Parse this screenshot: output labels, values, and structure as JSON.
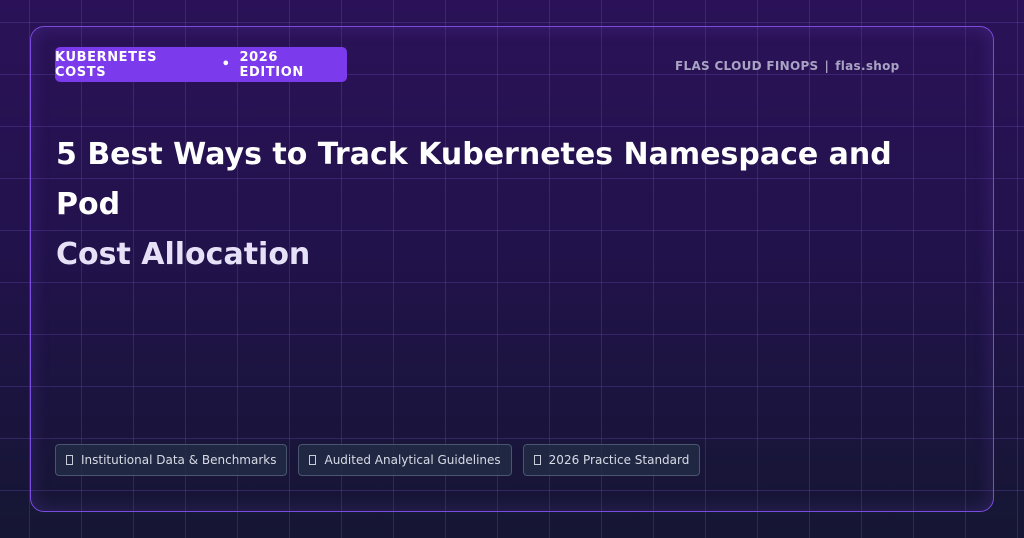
{
  "badge": {
    "category": "KUBERNETES COSTS",
    "separator": "•",
    "edition": "2026 EDITION"
  },
  "brand": {
    "name": "FLAS CLOUD FINOPS",
    "separator": "|",
    "domain": "flas.shop"
  },
  "title": {
    "line1": "5 Best Ways to Track Kubernetes Namespace and Pod",
    "line2": "Cost Allocation"
  },
  "chips": [
    {
      "icon": "missing-glyph-icon",
      "label": "Institutional Data & Benchmarks"
    },
    {
      "icon": "missing-glyph-icon",
      "label": "Audited Analytical Guidelines"
    },
    {
      "icon": "missing-glyph-icon",
      "label": "2026 Practice Standard"
    }
  ],
  "colors": {
    "accent": "#7c3aed",
    "border": "#7b4be0",
    "background_top": "#2b1258",
    "background_bottom": "#151633"
  }
}
